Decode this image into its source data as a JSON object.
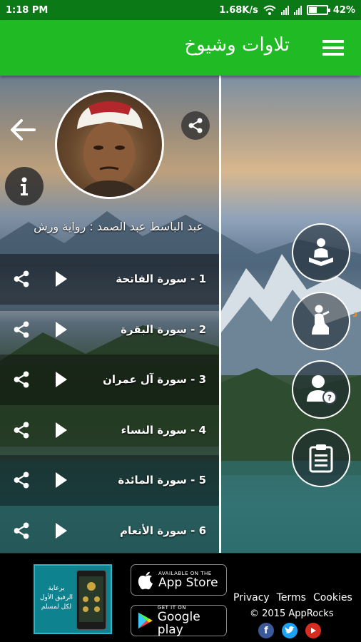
{
  "status_bar": {
    "time": "1:18 PM",
    "network_speed": "1.68K/s",
    "battery": "42%"
  },
  "app_bar": {
    "title": "تلاوات وشيوخ",
    "menu_icon": "hamburger-menu-icon"
  },
  "reciter": {
    "name": "عبد الباسط عبد الصمد : رواية ورش"
  },
  "surahs": [
    {
      "label": "1 - سورة الفاتحة"
    },
    {
      "label": "2 - سورة البقرة"
    },
    {
      "label": "3 - سورة آل عمران"
    },
    {
      "label": "4 - سورة النساء"
    },
    {
      "label": "5 - سورة المائدة"
    },
    {
      "label": "6 - سورة الأنعام"
    }
  ],
  "side_icons": [
    "quran-reader-icon",
    "prayer-icon",
    "user-help-icon",
    "clipboard-icon"
  ],
  "side_partial_text": "د",
  "footer": {
    "promo": {
      "line1": "برعاية",
      "line2": "الرفيق الأول",
      "line3": "لكل لمسلم"
    },
    "app_store": {
      "small": "AVAILABLE ON THE",
      "big": "App Store"
    },
    "google_play": {
      "small": "GET IT ON",
      "big": "Google play"
    },
    "links": {
      "privacy": "Privacy",
      "terms": "Terms",
      "cookies": "Cookies"
    },
    "copyright": "© 2015 AppRocks",
    "social_colors": {
      "facebook": "#3b5998",
      "twitter": "#1da1f2",
      "youtube": "#d62d20"
    }
  }
}
